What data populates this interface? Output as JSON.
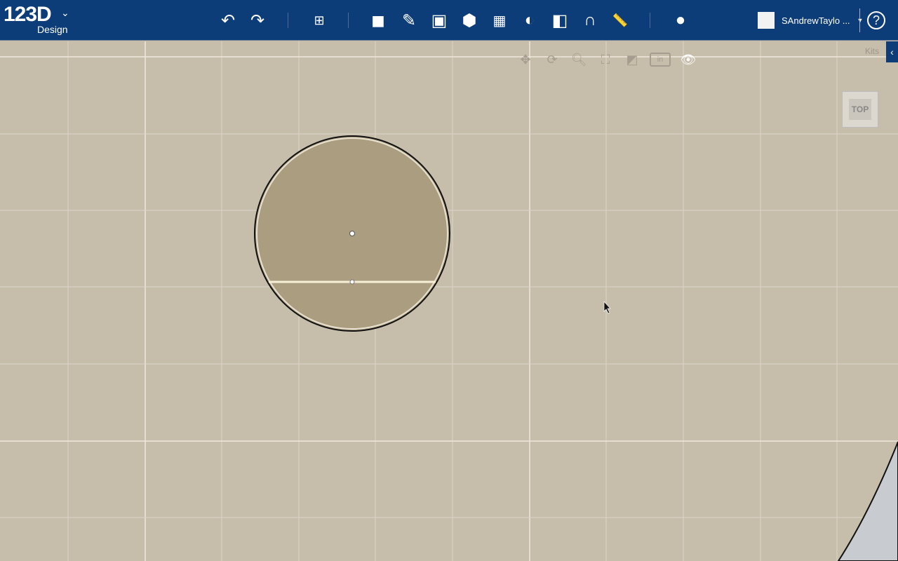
{
  "app": {
    "logo": "123D",
    "logo_sub": "Design"
  },
  "toolbar": {
    "tools": [
      "undo",
      "redo",
      "transform",
      "primitives",
      "sketch",
      "construct",
      "modify",
      "pattern",
      "grouping",
      "combine",
      "snap",
      "measure",
      "material"
    ]
  },
  "user": {
    "name": "SAndrewTaylo ..."
  },
  "help": {
    "label": "?"
  },
  "navigation": {
    "tools": [
      "pan",
      "orbit",
      "zoom",
      "fit",
      "view-mode",
      "units",
      "visibility"
    ],
    "units_label": "in"
  },
  "kits": {
    "label": "Kits"
  },
  "viewcube": {
    "label": "TOP"
  },
  "colors": {
    "topbar": "#0c3d78",
    "canvas": "#c6bdab",
    "shape": "#aa9d80"
  }
}
